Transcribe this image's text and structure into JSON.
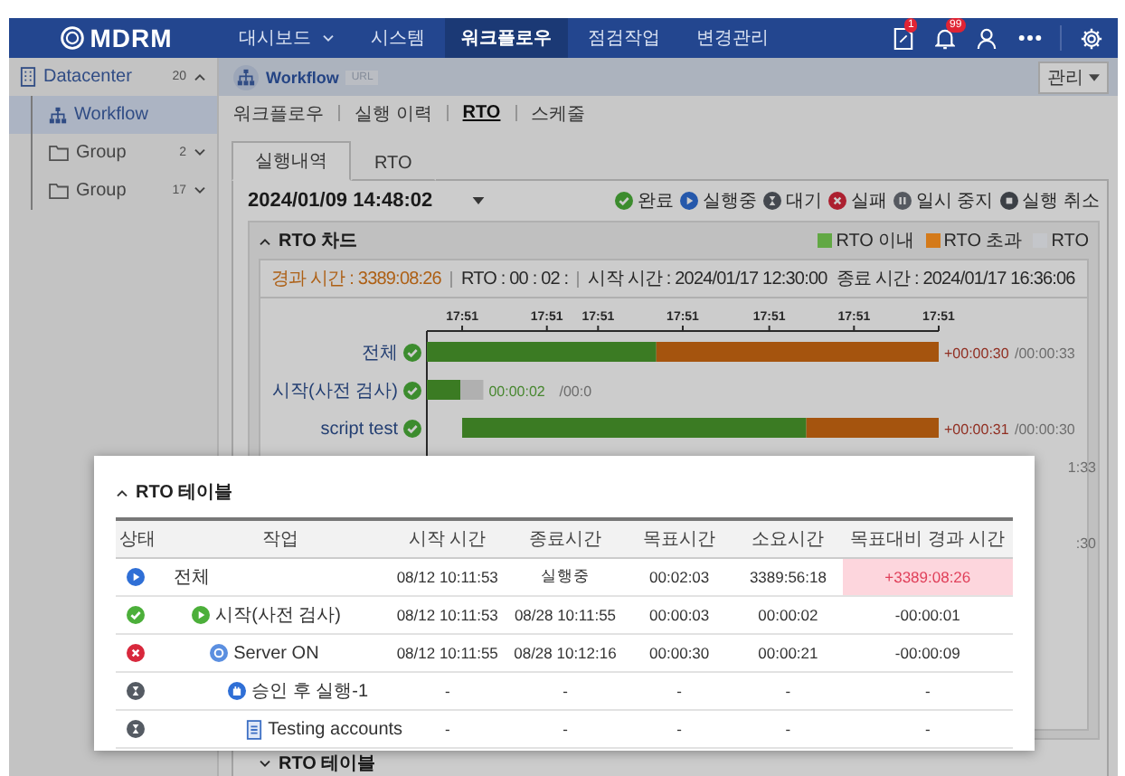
{
  "header": {
    "logo": "MDRM",
    "nav": [
      {
        "label": "대시보드",
        "selected": false,
        "dropdown": true
      },
      {
        "label": "시스템",
        "selected": false,
        "dropdown": false
      },
      {
        "label": "워크플로우",
        "selected": true,
        "dropdown": false
      },
      {
        "label": "점검작업",
        "selected": false,
        "dropdown": false
      },
      {
        "label": "변경관리",
        "selected": false,
        "dropdown": false
      }
    ],
    "document_badge": "1",
    "bell_badge": "99"
  },
  "sidebar": {
    "items": [
      {
        "label": "Datacenter",
        "count": "20",
        "kind": "datacenter",
        "expanded": true,
        "selected": false,
        "children": [
          {
            "label": "Workflow",
            "kind": "workflow",
            "selected": true
          },
          {
            "label": "Group",
            "count": "2",
            "kind": "folder",
            "expanded": false,
            "selected": false
          },
          {
            "label": "Group",
            "count": "17",
            "kind": "folder",
            "expanded": false,
            "selected": false
          }
        ]
      }
    ]
  },
  "page": {
    "title": "Workflow",
    "badge": "URL",
    "manage_button": "관리"
  },
  "subnav": [
    {
      "label": "워크플로우",
      "selected": false
    },
    {
      "label": "실행 이력",
      "selected": false
    },
    {
      "label": "RTO",
      "selected": true
    },
    {
      "label": "스케줄",
      "selected": false
    }
  ],
  "tabs": [
    {
      "label": "실행내역",
      "selected": true
    },
    {
      "label": "RTO",
      "selected": false
    }
  ],
  "run_date": "2024/01/09 14:48:02",
  "status_legend": [
    {
      "kind": "done",
      "label": "완료"
    },
    {
      "kind": "running",
      "label": "실행중"
    },
    {
      "kind": "waiting",
      "label": "대기"
    },
    {
      "kind": "failed",
      "label": "실패"
    },
    {
      "kind": "paused",
      "label": "일시 중지"
    },
    {
      "kind": "cancelled",
      "label": "실행 취소"
    }
  ],
  "rto_chart": {
    "title": "RTO 차드",
    "expanded": true,
    "legend": [
      {
        "label": "RTO 이내",
        "color": "#62a844"
      },
      {
        "label": "RTO 초과",
        "color": "#d47a1a"
      },
      {
        "label": "RTO",
        "color": "#c4c6ca"
      }
    ],
    "elapsed": "경과 시간 : 3389:08:26",
    "rto": "RTO : 00 : 02 :",
    "start": "시작 시간 : 2024/01/17 12:30:00",
    "end": "종료 시간 : 2024/01/17 16:36:06",
    "ticks": [
      "17:51",
      "17:51",
      "17:51",
      "17:51",
      "17:51",
      "17:51",
      "17:51"
    ],
    "rows": [
      {
        "label": "전체",
        "kind": "done",
        "reading": "+00:00:30",
        "over_target": true,
        "target": "/00:00:33"
      },
      {
        "label": "시작(사전 검사)",
        "kind": "done",
        "reading": "00:00:02",
        "over_target": false,
        "target": "/00:0"
      },
      {
        "label": "script test",
        "kind": "done",
        "reading": "+00:00:31",
        "over_target": true,
        "target": "/00:00:30"
      }
    ],
    "partial_readings": [
      "1:33",
      ":30"
    ]
  },
  "rto_table": {
    "title": "RTO 테이블",
    "expanded": true,
    "columns": [
      "상태",
      "작업",
      "시작 시간",
      "종료시간",
      "목표시간",
      "소요시간",
      "목표대비 경과 시간"
    ],
    "rows": [
      {
        "kind": "running",
        "task": "전체",
        "start": "08/12 10:11:53",
        "end": "실행중",
        "target": "00:02:03",
        "duration": "3389:56:18",
        "diff": "+3389:08:26",
        "over_target": true,
        "children": [
          {
            "kind": "done",
            "task_icon": {
              "kind": "start"
            },
            "task": "시작(사전 검사)",
            "start": "08/12 10:11:53",
            "end": "08/28 10:11:55",
            "target": "00:00:03",
            "duration": "00:00:02",
            "diff": "-00:00:01",
            "over_target": false,
            "children": [
              {
                "kind": "failed",
                "task_icon": {
                  "kind": "server"
                },
                "task": "Server ON",
                "start": "08/12 10:11:55",
                "end": "08/28 10:12:16",
                "target": "00:00:30",
                "duration": "00:00:21",
                "diff": "-00:00:09",
                "over_target": false,
                "children": [
                  {
                    "kind": "waiting",
                    "task_icon": {
                      "kind": "approval"
                    },
                    "task": "승인 후 실행-1",
                    "start": "-",
                    "end": "-",
                    "target": "-",
                    "duration": "-",
                    "diff": "-",
                    "over_target": false,
                    "children": [
                      {
                        "kind": "waiting",
                        "task_icon": {
                          "kind": "document"
                        },
                        "task": "Testing accounts",
                        "start": "-",
                        "end": "-",
                        "target": "-",
                        "duration": "-",
                        "diff": "-",
                        "over_target": false
                      }
                    ]
                  }
                ]
              }
            ]
          }
        ]
      }
    ]
  },
  "next_section": "RTO 테이블"
}
